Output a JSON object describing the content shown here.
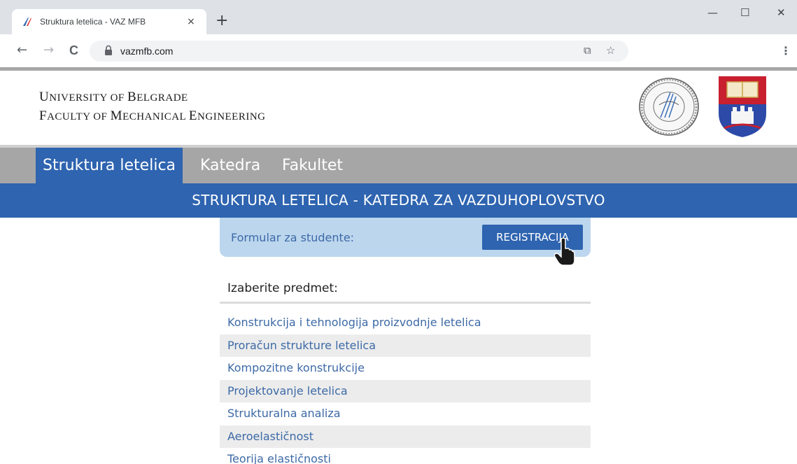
{
  "browser": {
    "tab_title": "Struktura letelica - VAZ MFB",
    "tab_close": "×",
    "new_tab": "+",
    "url": "vazmfb.com",
    "window_min": "—",
    "window_max": "☐",
    "window_close": "✕",
    "back": "←",
    "forward": "→",
    "reload": "C",
    "translate_icon": "⧉",
    "bookmark_icon": "☆",
    "menu": "⋮"
  },
  "header": {
    "line1_first": "U",
    "line1_rest": "niversity of ",
    "line1_b": "B",
    "line1_rest2": "elgrade",
    "line2_first": "F",
    "line2_rest": "aculty of ",
    "line2_m": "M",
    "line2_rest2": "echanical ",
    "line2_e": "E",
    "line2_rest3": "ngineering"
  },
  "nav": {
    "items": [
      {
        "label": "Struktura letelica",
        "active": true
      },
      {
        "label": "Katedra",
        "active": false
      },
      {
        "label": "Fakultet",
        "active": false
      }
    ]
  },
  "banner": {
    "text": "STRUKTURA LETELICA - KATEDRA ZA VAZDUHOPLOVSTVO"
  },
  "registration": {
    "label": "Formular za studente:",
    "button": "REGISTRACIJA"
  },
  "subjects": {
    "title": "Izaberite predmet:",
    "items": [
      "Konstrukcija i tehnologija proizvodnje letelica",
      "Proračun strukture letelica",
      "Kompozitne konstrukcije",
      "Projektovanje letelica",
      "Strukturalna analiza",
      "Aeroelastičnost",
      "Teorija elastičnosti"
    ]
  },
  "colors": {
    "brand_blue": "#2e64b0",
    "nav_gray": "#a6a6a6",
    "link_blue": "#3d6aa6",
    "reg_box_bg": "#bcd6ee",
    "crest_red": "#c8202f"
  }
}
